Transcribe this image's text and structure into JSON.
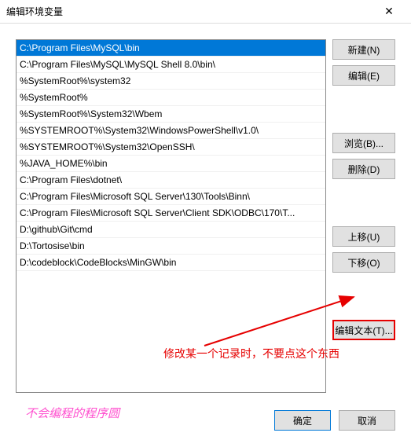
{
  "title": "编辑环境变量",
  "list_items": [
    "C:\\Program Files\\MySQL\\bin",
    "C:\\Program Files\\MySQL\\MySQL Shell 8.0\\bin\\",
    "%SystemRoot%\\system32",
    "%SystemRoot%",
    "%SystemRoot%\\System32\\Wbem",
    "%SYSTEMROOT%\\System32\\WindowsPowerShell\\v1.0\\",
    "%SYSTEMROOT%\\System32\\OpenSSH\\",
    "%JAVA_HOME%\\bin",
    "C:\\Program Files\\dotnet\\",
    "C:\\Program Files\\Microsoft SQL Server\\130\\Tools\\Binn\\",
    "C:\\Program Files\\Microsoft SQL Server\\Client SDK\\ODBC\\170\\T...",
    "D:\\github\\Git\\cmd",
    "D:\\Tortosise\\bin",
    "D:\\codeblock\\CodeBlocks\\MinGW\\bin"
  ],
  "selected_index": 0,
  "buttons": {
    "new": "新建(N)",
    "edit": "编辑(E)",
    "browse": "浏览(B)...",
    "delete": "删除(D)",
    "up": "上移(U)",
    "down": "下移(O)",
    "edit_text": "编辑文本(T)...",
    "ok": "确定",
    "cancel": "取消"
  },
  "annotation_text": "修改某一个记录时，不要点这个东西",
  "signature": "不会编程的程序圆"
}
